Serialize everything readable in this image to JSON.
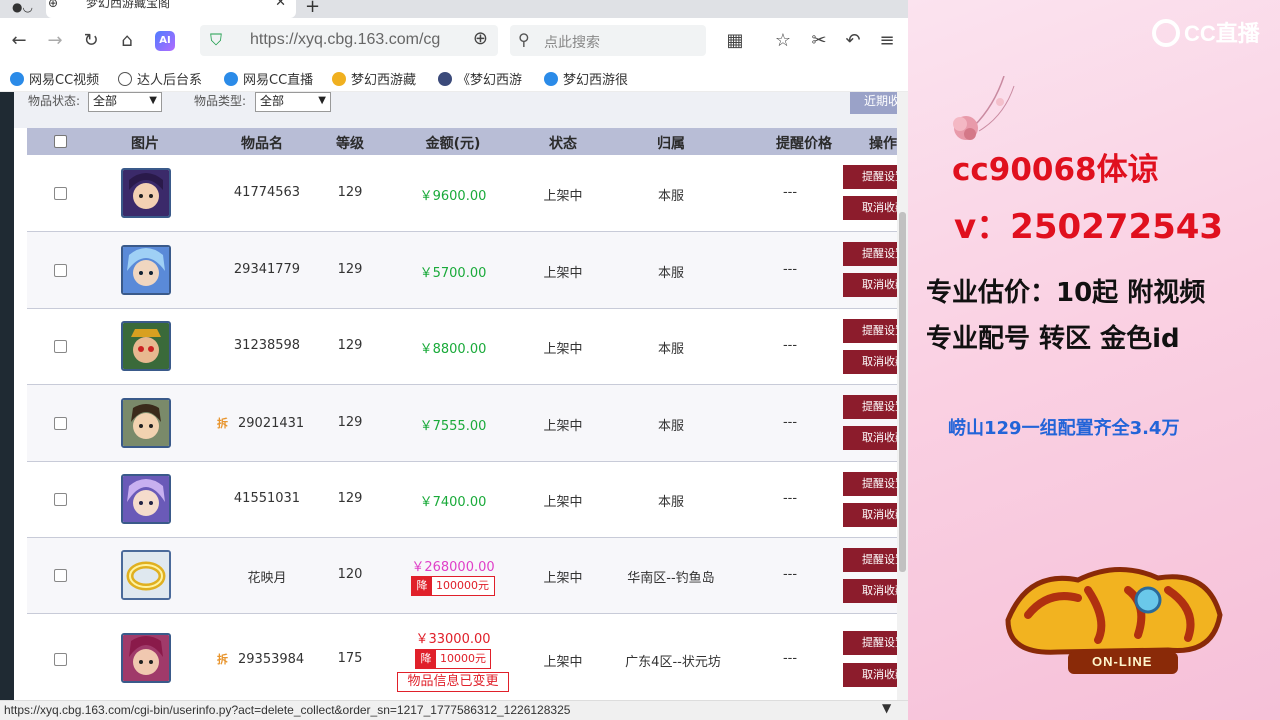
{
  "browser": {
    "tab_title": "梦幻西游藏宝阁",
    "url": "https://xyq.cbg.163.com/cg",
    "search_placeholder": "点此搜索",
    "ai_label": "AI",
    "bookmarks": [
      "网易CC视频",
      "达人后台系",
      "网易CC直播",
      "梦幻西游藏",
      "《梦幻西游",
      "梦幻西游很"
    ],
    "status_url": "https://xyq.cbg.163.com/cgi-bin/userinfo.py?act=delete_collect&order_sn=1217_1777586312_1226128325"
  },
  "filters": {
    "status_label": "物品状态:",
    "status_value": "全部",
    "type_label": "物品类型:",
    "type_value": "全部",
    "recent_button": "近期收"
  },
  "table": {
    "headers": [
      "图片",
      "物品名",
      "等级",
      "金额(元)",
      "状态",
      "归属",
      "提醒价格",
      "操作"
    ],
    "rows": [
      {
        "name": "41774563",
        "level": "129",
        "price": "￥9600.00",
        "status": "上架中",
        "server": "本服",
        "remind": "---",
        "btn1": "提醒设置",
        "btn2": "取消收藏"
      },
      {
        "name": "29341779",
        "level": "129",
        "price": "￥5700.00",
        "status": "上架中",
        "server": "本服",
        "remind": "---",
        "btn1": "提醒设置",
        "btn2": "取消收藏"
      },
      {
        "name": "31238598",
        "level": "129",
        "price": "￥8800.00",
        "status": "上架中",
        "server": "本服",
        "remind": "---",
        "btn1": "提醒设置",
        "btn2": "取消收藏"
      },
      {
        "name": "29021431",
        "tag": "拆",
        "level": "129",
        "price": "￥7555.00",
        "status": "上架中",
        "server": "本服",
        "remind": "---",
        "btn1": "提醒设置",
        "btn2": "取消收藏"
      },
      {
        "name": "41551031",
        "level": "129",
        "price": "￥7400.00",
        "status": "上架中",
        "server": "本服",
        "remind": "---",
        "btn1": "提醒设置",
        "btn2": "取消收藏"
      },
      {
        "name": "花映月",
        "level": "120",
        "price": "￥268000.00",
        "drop_tag": "降",
        "drop": "100000元",
        "status": "上架中",
        "server": "华南区--钓鱼岛",
        "remind": "---",
        "btn1": "提醒设置",
        "btn2": "取消收藏"
      },
      {
        "name": "29353984",
        "tag": "拆",
        "level": "175",
        "price": "￥33000.00",
        "drop_tag": "降",
        "drop": "10000元",
        "changed": "物品信息已变更",
        "status": "上架中",
        "server": "广东4区--状元坊",
        "remind": "---",
        "btn1": "提醒设置",
        "btn2": "取消收藏"
      }
    ]
  },
  "panel": {
    "logo_text": "CC直播",
    "contact_id": "cc90068体谅",
    "contact_v": "v：250272543",
    "promo_1": "专业估价：10起  附视频",
    "promo_2": "专业配号   转区   金色id",
    "deal": "崂山129一组配置齐全3.4万",
    "game_logo_text": "ON-LINE",
    "colors": {
      "accent_red": "#e0101e",
      "deal_blue": "#2364d8",
      "price_green": "#1aaa3a",
      "button_maroon": "#8c1c2c"
    }
  }
}
